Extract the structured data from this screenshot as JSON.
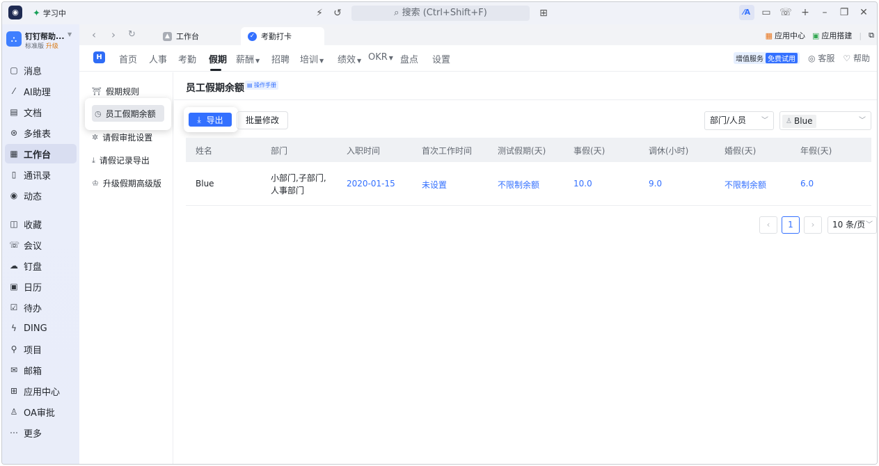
{
  "titlebar": {
    "status": "学习中",
    "search_placeholder": "搜索 (Ctrl+Shift+F)"
  },
  "org": {
    "name": "钉钉帮助...",
    "edition": "标准版",
    "upgrade": "升级"
  },
  "sidebar": {
    "items": [
      {
        "label": "消息",
        "icon": "message-icon"
      },
      {
        "label": "AI助理",
        "icon": "ai-assistant-icon"
      },
      {
        "label": "文档",
        "icon": "document-icon"
      },
      {
        "label": "多维表",
        "icon": "table-icon"
      },
      {
        "label": "工作台",
        "icon": "workbench-icon",
        "active": true
      },
      {
        "label": "通讯录",
        "icon": "contacts-icon"
      },
      {
        "label": "动态",
        "icon": "feed-icon"
      },
      {
        "label": "收藏",
        "icon": "favorites-icon"
      },
      {
        "label": "会议",
        "icon": "meeting-icon"
      },
      {
        "label": "钉盘",
        "icon": "cloud-drive-icon"
      },
      {
        "label": "日历",
        "icon": "calendar-icon"
      },
      {
        "label": "待办",
        "icon": "todo-icon"
      },
      {
        "label": "DING",
        "icon": "ding-icon"
      },
      {
        "label": "项目",
        "icon": "project-icon"
      },
      {
        "label": "邮箱",
        "icon": "mail-icon"
      },
      {
        "label": "应用中心",
        "icon": "app-center-icon"
      },
      {
        "label": "OA审批",
        "icon": "approval-icon"
      },
      {
        "label": "更多",
        "icon": "more-icon"
      }
    ]
  },
  "tabs": {
    "workbench": "工作台",
    "attendance": "考勤打卡",
    "app_center": "应用中心",
    "app_builder": "应用搭建"
  },
  "menu": {
    "items": [
      "首页",
      "人事",
      "考勤",
      "假期",
      "薪酬",
      "招聘",
      "培训",
      "绩效",
      "OKR",
      "盘点",
      "设置"
    ],
    "active": "假期",
    "value_added": "增值服务",
    "free_trial": "免费试用",
    "service": "客服",
    "help": "帮助"
  },
  "subnav": {
    "items": [
      "假期规则",
      "员工假期余额",
      "请假审批设置",
      "请假记录导出",
      "升级假期高级版"
    ],
    "active": "员工假期余额"
  },
  "page": {
    "title": "员工假期余额",
    "manual": "操作手册",
    "export": "导出",
    "bulk_edit": "批量修改",
    "dept_filter": "部门/人员",
    "person_filter": "Blue"
  },
  "table": {
    "columns": [
      "姓名",
      "部门",
      "入职时间",
      "首次工作时间",
      "测试假期(天)",
      "事假(天)",
      "调休(小时)",
      "婚假(天)",
      "年假(天)"
    ],
    "rows": [
      {
        "name": "Blue",
        "dept_line1": "小部门,子部门,",
        "dept_line2": "人事部门",
        "hire_date": "2020-01-15",
        "first_work": "未设置",
        "test_leave": "不限制余额",
        "personal_leave": "10.0",
        "comp_time": "9.0",
        "marriage_leave": "不限制余额",
        "annual_leave": "6.0"
      }
    ]
  },
  "pagination": {
    "current": "1",
    "page_size": "10 条/页"
  }
}
